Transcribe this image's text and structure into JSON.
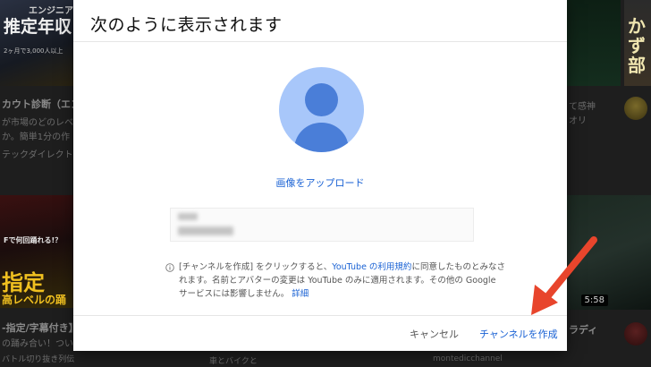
{
  "background": {
    "left_col": {
      "thumb1_line1": "エンジニア",
      "thumb1_line2": "推定年収",
      "thumb1_line3": "2ヶ月で3,000人以上",
      "title_1": "カウト診断（エン",
      "desc_1a": "が市場のどのレベ",
      "desc_1b": "か。簡単1分の作",
      "channel_1": "テックダイレクト",
      "thumb2_top": "Fで何回踊れる!？",
      "thumb2_big": "指定",
      "thumb2_sub": "高レベルの踊",
      "title_2": "-指定/字幕付き】",
      "desc_2": "の踊み合い！つい",
      "channel_2": "バトル切り抜き列伝"
    },
    "right_col": {
      "thumb_text": "かず部",
      "desc_1a": "て感神",
      "desc_1b": "オリ",
      "duration": "5:58",
      "title_2": "ラディ",
      "channel_2": "montedicchannel",
      "below_dialog": "車とバイクと"
    }
  },
  "dialog": {
    "title": "次のように表示されます",
    "upload_label": "画像をアップロード",
    "notice_part1": "[チャンネルを作成] をクリックすると、",
    "notice_link_terms": "YouTube の利用規約",
    "notice_part2": "に同意したものとみなされます。名前とアバターの変更は YouTube のみに適用されます。その他の Google サービスには影響しません。",
    "notice_link_details": "詳細",
    "cancel_label": "キャンセル",
    "create_label": "チャンネルを作成"
  },
  "colors": {
    "accent": "#1a62d4",
    "avatar_light": "#a8c7fa",
    "avatar_dark": "#4a7ed8",
    "annotation_arrow": "#e8452c"
  },
  "icons": {
    "avatar": "default-avatar-icon",
    "info": "info-icon",
    "arrow": "annotation-arrow-icon"
  }
}
